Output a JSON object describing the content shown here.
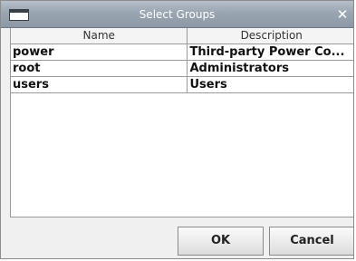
{
  "window": {
    "title": "Select Groups",
    "close_glyph": "✕"
  },
  "table": {
    "columns": [
      "Name",
      "Description"
    ],
    "rows": [
      {
        "name": "power",
        "description": "Third-party Power Co..."
      },
      {
        "name": "root",
        "description": "Administrators"
      },
      {
        "name": "users",
        "description": "Users"
      }
    ]
  },
  "buttons": {
    "ok_label": "OK",
    "cancel_label": "Cancel"
  },
  "icons": {
    "window_icon": "window-icon",
    "close_icon": "close-icon"
  },
  "colors": {
    "titlebar": "#9aa5b2",
    "dialog_bg": "#f0f0f0",
    "table_bg": "#ffffff",
    "grid_line": "#9a9a9a"
  }
}
